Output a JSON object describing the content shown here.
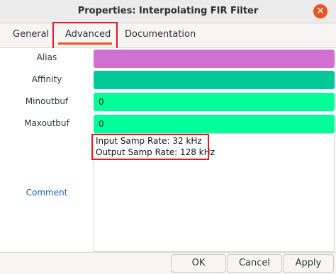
{
  "window": {
    "title": "Properties: Interpolating FIR Filter"
  },
  "tabs": [
    {
      "label": "General"
    },
    {
      "label": "Advanced"
    },
    {
      "label": "Documentation"
    }
  ],
  "fields": {
    "alias": {
      "label": "Alias",
      "value": "",
      "color": "#d070d0"
    },
    "affinity": {
      "label": "Affinity",
      "value": "",
      "color": "#00c896"
    },
    "minoutbuf": {
      "label": "Minoutbuf",
      "value": "0",
      "color": "#00ff99"
    },
    "maxoutbuf": {
      "label": "Maxoutbuf",
      "value": "0",
      "color": "#00ff99"
    },
    "comment": {
      "label": "Comment",
      "lines": [
        "Input Samp Rate: 32 kHz",
        "Output Samp Rate: 128 kHz"
      ]
    }
  },
  "buttons": {
    "ok": "OK",
    "cancel": "Cancel",
    "apply": "Apply"
  },
  "colors": {
    "accent": "#e95420",
    "highlight": "#e01b24",
    "link": "#1a5fb4"
  }
}
